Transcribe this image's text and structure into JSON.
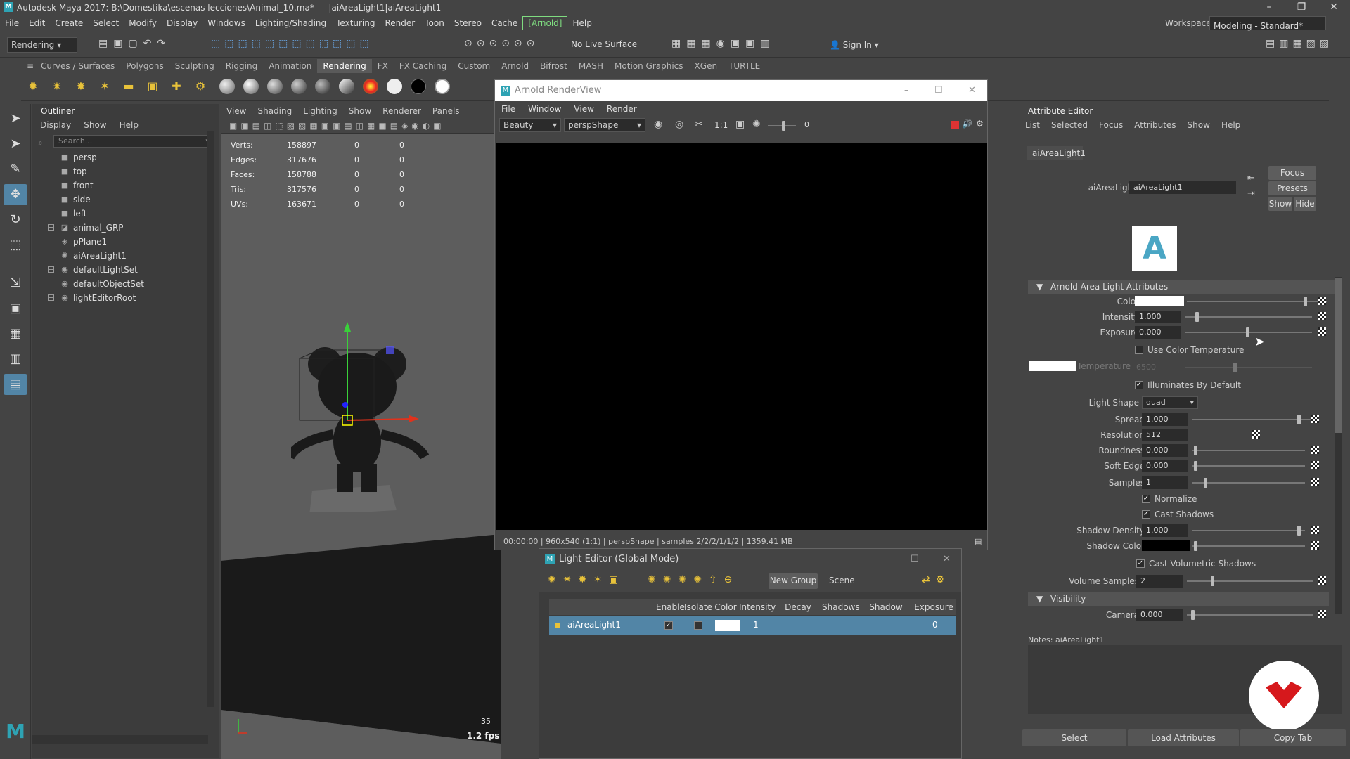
{
  "window": {
    "title": "Autodesk Maya 2017: B:\\Domestika\\escenas lecciones\\Animal_10.ma*   ---   |aiAreaLight1|aiAreaLight1",
    "workspace_label": "Workspace :",
    "workspace_value": "Modeling - Standard*"
  },
  "menubar": [
    "File",
    "Edit",
    "Create",
    "Select",
    "Modify",
    "Display",
    "Windows",
    "Lighting/Shading",
    "Texturing",
    "Render",
    "Toon",
    "Stereo",
    "Cache",
    "[Arnold]",
    "Help"
  ],
  "toolbar": {
    "mode": "Rendering",
    "live_surface": "No Live Surface",
    "sign_in": "Sign In"
  },
  "shelf_tabs": [
    "Curves / Surfaces",
    "Polygons",
    "Sculpting",
    "Rigging",
    "Animation",
    "Rendering",
    "FX",
    "FX Caching",
    "Custom",
    "Arnold",
    "Bifrost",
    "MASH",
    "Motion Graphics",
    "XGen",
    "TURTLE"
  ],
  "shelf_active": "Rendering",
  "outliner": {
    "title": "Outliner",
    "menu": [
      "Display",
      "Show",
      "Help"
    ],
    "search_placeholder": "Search...",
    "items": [
      {
        "label": "persp",
        "icon": "camera-icon",
        "expandable": false
      },
      {
        "label": "top",
        "icon": "camera-icon",
        "expandable": false
      },
      {
        "label": "front",
        "icon": "camera-icon",
        "expandable": false
      },
      {
        "label": "side",
        "icon": "camera-icon",
        "expandable": false
      },
      {
        "label": "left",
        "icon": "camera-icon",
        "expandable": false
      },
      {
        "label": "animal_GRP",
        "icon": "group-icon",
        "expandable": true
      },
      {
        "label": "pPlane1",
        "icon": "mesh-icon",
        "expandable": false
      },
      {
        "label": "aiAreaLight1",
        "icon": "light-icon",
        "expandable": false
      },
      {
        "label": "defaultLightSet",
        "icon": "set-icon",
        "expandable": true
      },
      {
        "label": "defaultObjectSet",
        "icon": "set-icon",
        "expandable": false
      },
      {
        "label": "lightEditorRoot",
        "icon": "set-icon",
        "expandable": true
      }
    ]
  },
  "viewport": {
    "menu": [
      "View",
      "Shading",
      "Lighting",
      "Show",
      "Renderer",
      "Panels"
    ],
    "hud": [
      {
        "k": "Verts:",
        "v": "158897",
        "a": "0",
        "b": "0"
      },
      {
        "k": "Edges:",
        "v": "317676",
        "a": "0",
        "b": "0"
      },
      {
        "k": "Faces:",
        "v": "158788",
        "a": "0",
        "b": "0"
      },
      {
        "k": "Tris:",
        "v": "317576",
        "a": "0",
        "b": "0"
      },
      {
        "k": "UVs:",
        "v": "163671",
        "a": "0",
        "b": "0"
      }
    ],
    "frame_number": "35",
    "fps": "1.2 fps"
  },
  "renderview": {
    "title": "Arnold RenderView",
    "menu": [
      "File",
      "Window",
      "View",
      "Render"
    ],
    "aov": "Beauty",
    "camera": "perspShape",
    "ratio": "1:1",
    "exposure": "0",
    "status": "00:00:00 | 960x540 (1:1) | perspShape  | samples 2/2/2/1/1/2 | 1359.41 MB"
  },
  "light_editor": {
    "title": "Light Editor (Global Mode)",
    "new_group": "New Group",
    "scene": "Scene",
    "columns": [
      "Enable",
      "Isolate",
      "Color",
      "Intensity",
      "Decay Rate",
      "Shadows",
      "Shadow Rays",
      "Exposure"
    ],
    "row": {
      "name": "aiAreaLight1",
      "intensity": "1",
      "exposure": "0"
    }
  },
  "attribute_editor": {
    "title": "Attribute Editor",
    "menu": [
      "List",
      "Selected",
      "Focus",
      "Attributes",
      "Show",
      "Help"
    ],
    "tab": "aiAreaLight1",
    "node_label": "aiAreaLight:",
    "node_value": "aiAreaLight1",
    "btn_focus": "Focus",
    "btn_presets": "Presets",
    "btn_show": "Show",
    "btn_hide": "Hide",
    "section": "Arnold Area Light Attributes",
    "color_label": "Color",
    "intensity_label": "Intensity",
    "intensity": "1.000",
    "exposure_label": "Exposure",
    "exposure": "0.000",
    "use_color_temp": "Use Color Temperature",
    "temperature_label": "Temperature",
    "temperature": "6500",
    "illuminates": "Illuminates By Default",
    "light_shape_label": "Light Shape",
    "light_shape": "quad",
    "spread_label": "Spread",
    "spread": "1.000",
    "resolution_label": "Resolution",
    "resolution": "512",
    "roundness_label": "Roundness",
    "roundness": "0.000",
    "soft_edge_label": "Soft Edge",
    "soft_edge": "0.000",
    "samples_label": "Samples",
    "samples": "1",
    "normalize": "Normalize",
    "cast_shadows": "Cast Shadows",
    "shadow_density_label": "Shadow Density",
    "shadow_density": "1.000",
    "shadow_color_label": "Shadow Color",
    "cast_volumetric": "Cast Volumetric Shadows",
    "volume_samples_label": "Volume Samples",
    "volume_samples": "2",
    "visibility_section": "Visibility",
    "camera_label": "Camera",
    "camera": "0.000",
    "notes": "Notes:  aiAreaLight1",
    "btn_select": "Select",
    "btn_load": "Load Attributes",
    "btn_copy": "Copy Tab"
  },
  "colors": {
    "accent_blue": "#5285a6",
    "arnold_green": "#7fdc80",
    "badge_red": "#d6181c"
  }
}
